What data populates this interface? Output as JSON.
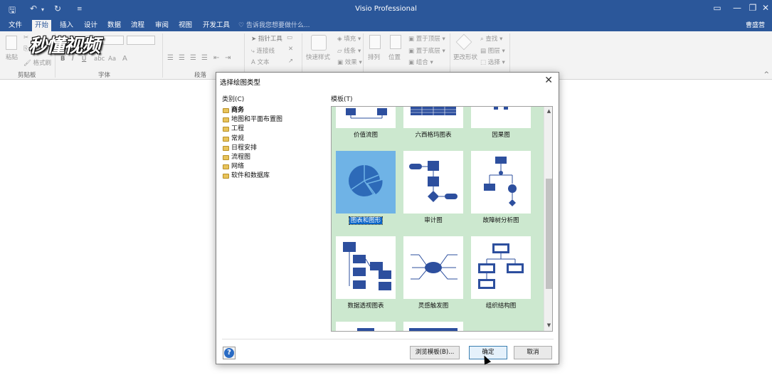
{
  "app": {
    "title": "Visio Professional",
    "qat_icons": [
      "save-icon",
      "undo-icon",
      "redo-icon",
      "customize-icon"
    ]
  },
  "menu": {
    "tabs": [
      "文件",
      "开始",
      "插入",
      "设计",
      "数据",
      "流程",
      "审阅",
      "视图",
      "开发工具"
    ],
    "active_tab": "开始",
    "tell_me": "告诉我您想要做什么...",
    "user": "曹盛营"
  },
  "ribbon": {
    "clipboard": {
      "paste": "粘贴",
      "format_painter": "格式刷",
      "label": "剪贴板"
    },
    "font": {
      "bold": "B",
      "italic": "I",
      "underline": "U",
      "label": "字体"
    },
    "paragraph": {
      "label": "段落"
    },
    "tools": {
      "pointer": "指针工具",
      "connector": "连接线",
      "text": "文本"
    },
    "shape_styles": {
      "quick_styles": "快速样式",
      "fill": "填充",
      "line": "线条",
      "effects": "效果"
    },
    "arrange": {
      "align": "排列",
      "position": "位置",
      "bring_front": "置于顶层",
      "send_back": "置于底层",
      "group": "组合"
    },
    "editing": {
      "change_shape": "更改形状",
      "find": "查找",
      "layers": "图层",
      "select": "选择"
    }
  },
  "watermark": "秒懂视频",
  "dialog": {
    "title": "选择绘图类型",
    "category_label": "类别(C)",
    "template_label": "模板(T)",
    "categories": [
      "商务",
      "地图和平面布置图",
      "工程",
      "常规",
      "日程安排",
      "流程图",
      "网络",
      "软件和数据库"
    ],
    "selected_category": "商务",
    "templates": [
      "价值流图",
      "六西格玛图表",
      "因果图",
      "图表和图形",
      "审计图",
      "故障树分析图",
      "数据透视图表",
      "灵感触发图",
      "组织结构图"
    ],
    "selected_template": "图表和图形",
    "buttons": {
      "browse": "浏览模板(B)...",
      "ok": "确定",
      "cancel": "取消"
    },
    "help": "?"
  },
  "colors": {
    "titlebar": "#2b579a",
    "gallery_bg": "#cce8cf",
    "selection": "#0a64c8",
    "shape_blue": "#2d4f9e"
  }
}
